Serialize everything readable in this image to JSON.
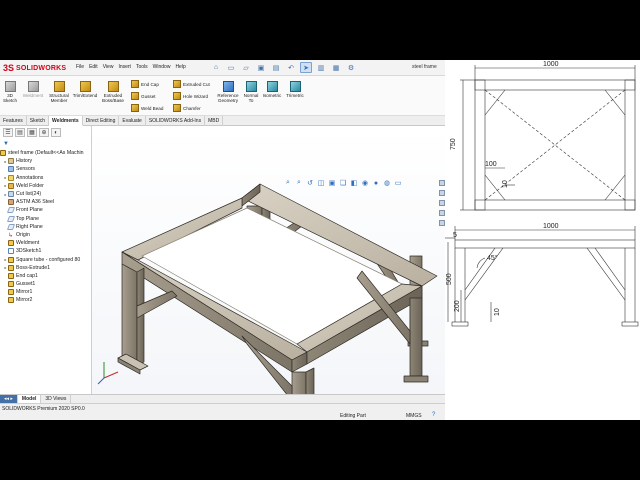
{
  "app": {
    "brand_ds": "3S",
    "brand": "SOLIDWORKS",
    "menus": [
      "File",
      "Edit",
      "View",
      "Insert",
      "Tools",
      "Window",
      "Help"
    ],
    "doc_title": "steel frame"
  },
  "ribbon": {
    "items": [
      {
        "label": "3D Sketch",
        "icon": "3d-sketch-icon"
      },
      {
        "label": "Weldment",
        "icon": "weldment-icon"
      },
      {
        "label": "Structural Member",
        "icon": "structural-member-icon"
      },
      {
        "label": "Trim/Extend",
        "icon": "trim-extend-icon"
      },
      {
        "label": "Extruded Boss/Base",
        "icon": "extruded-boss-icon"
      },
      {
        "label": "End Cap",
        "icon": "end-cap-icon"
      },
      {
        "label": "Gusset",
        "icon": "gusset-icon"
      },
      {
        "label": "Weld Bead",
        "icon": "weld-bead-icon"
      },
      {
        "label": "Extruded Cut",
        "icon": "extruded-cut-icon"
      },
      {
        "label": "Hole Wizard",
        "icon": "hole-wizard-icon"
      },
      {
        "label": "Chamfer",
        "icon": "chamfer-icon"
      },
      {
        "label": "Reference Geometry",
        "icon": "reference-geometry-icon"
      },
      {
        "label": "Normal To",
        "icon": "normal-to-icon"
      },
      {
        "label": "Isometric",
        "icon": "isometric-icon"
      },
      {
        "label": "Trimetric",
        "icon": "trimetric-icon"
      }
    ]
  },
  "command_tabs": [
    "Features",
    "Sketch",
    "Weldments",
    "Direct Editing",
    "Evaluate",
    "SOLIDWORKS Add-Ins",
    "MBD"
  ],
  "active_command_tab": "Weldments",
  "tree": {
    "root": "steel frame  (Default<<As Machin",
    "items": [
      {
        "label": "History",
        "icon": "history-icon",
        "expander": true
      },
      {
        "label": "Sensors",
        "icon": "sensors-icon",
        "expander": false
      },
      {
        "label": "Annotations",
        "icon": "annotations-icon",
        "expander": true
      },
      {
        "label": "Weld Folder",
        "icon": "weld-folder-icon",
        "expander": true
      },
      {
        "label": "Cut list(24)",
        "icon": "cut-list-icon",
        "expander": true
      },
      {
        "label": "ASTM A36 Steel",
        "icon": "material-icon",
        "expander": false
      },
      {
        "label": "Front Plane",
        "icon": "plane-icon",
        "expander": false
      },
      {
        "label": "Top Plane",
        "icon": "plane-icon",
        "expander": false
      },
      {
        "label": "Right Plane",
        "icon": "plane-icon",
        "expander": false
      },
      {
        "label": "Origin",
        "icon": "origin-icon",
        "expander": false
      },
      {
        "label": "Weldment",
        "icon": "weldment-icon",
        "expander": false
      },
      {
        "label": "3DSketch1",
        "icon": "sketch-icon",
        "expander": false
      },
      {
        "label": "Square tube - configured 80",
        "icon": "structural-member-icon",
        "expander": true
      },
      {
        "label": "Boss-Extrude1",
        "icon": "extrude-icon",
        "expander": true
      },
      {
        "label": "End cap1",
        "icon": "end-cap-icon",
        "expander": false
      },
      {
        "label": "Gusset1",
        "icon": "gusset-icon",
        "expander": false
      },
      {
        "label": "Mirror1",
        "icon": "mirror-icon",
        "expander": false
      },
      {
        "label": "Mirror2",
        "icon": "mirror-icon",
        "expander": false
      }
    ]
  },
  "bottom_tabs": [
    "Model",
    "3D Views"
  ],
  "active_bottom_tab": "Model",
  "status": {
    "product": "SOLIDWORKS Premium 2020 SP0.0",
    "mode": "Editing Part",
    "units": "MMGS"
  },
  "drawing": {
    "top_view": {
      "width": "1000",
      "depth": "750",
      "offset_a": "100",
      "offset_b": "10"
    },
    "front_view": {
      "width": "1000",
      "height": "500",
      "gusset_angle": "45°",
      "gusset_height": "200",
      "gusset_offset": "10",
      "left_offset": "5"
    }
  }
}
